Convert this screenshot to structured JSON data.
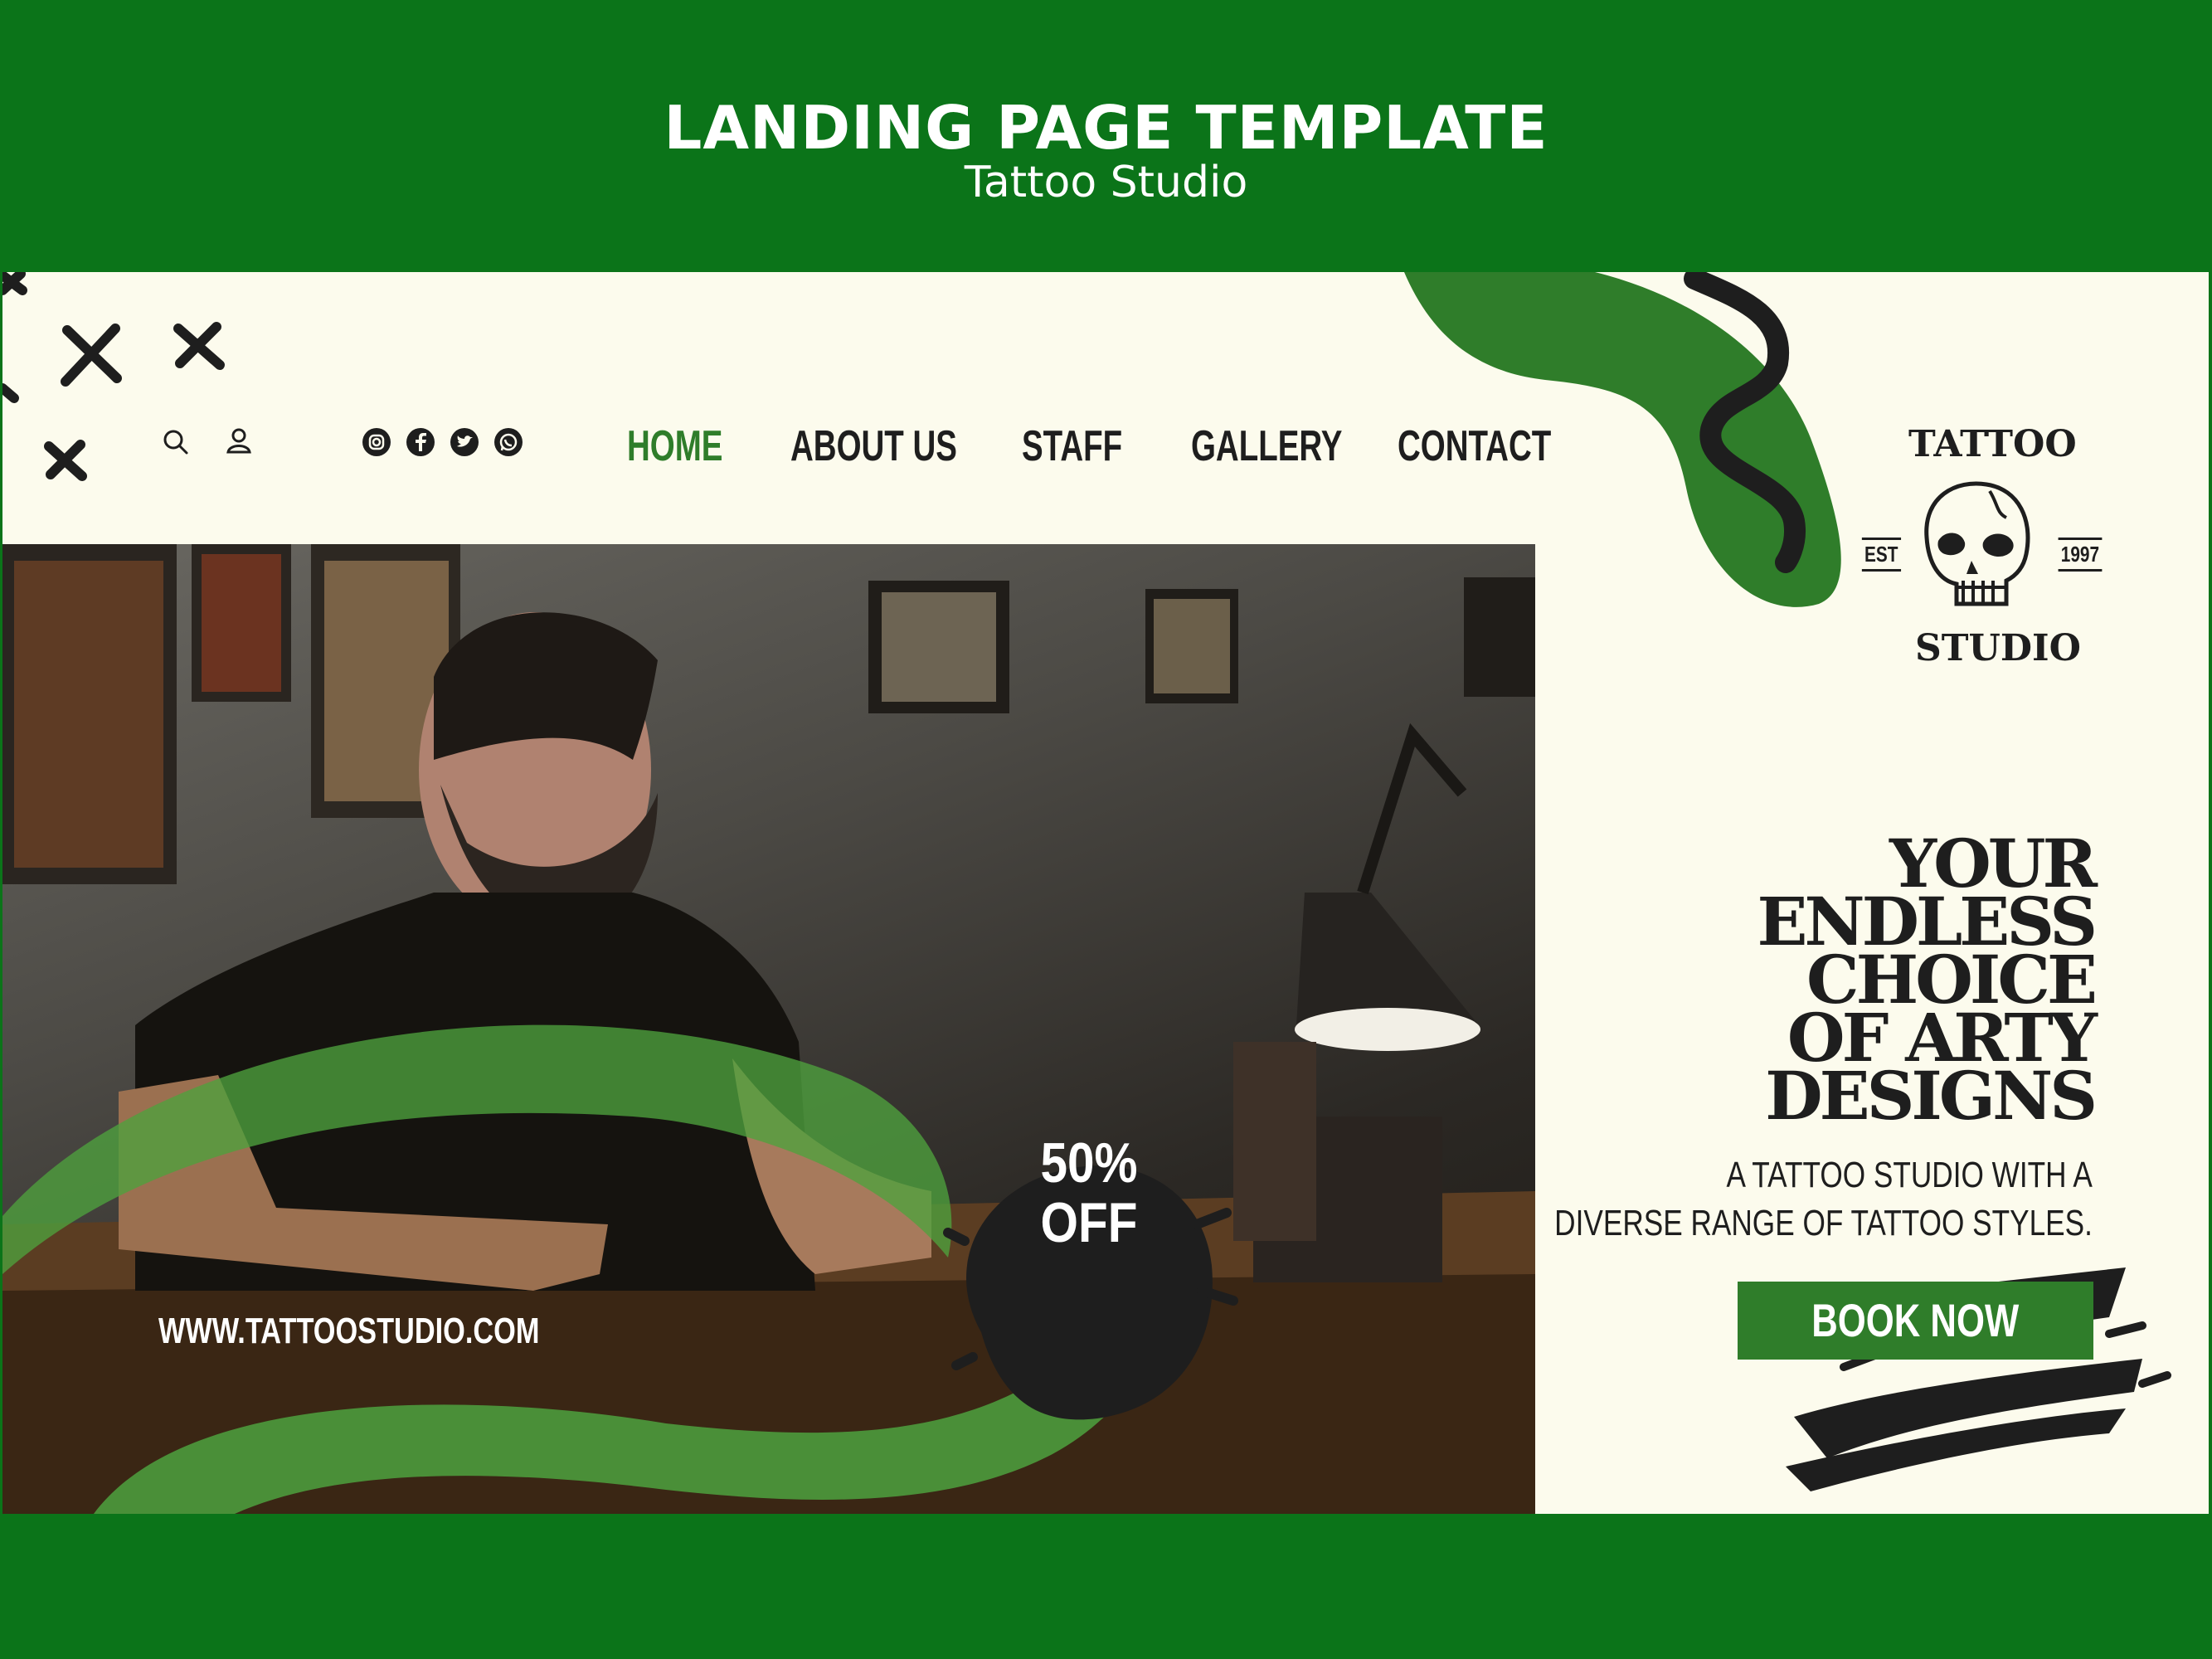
{
  "banner": {
    "title": "LANDING PAGE TEMPLATE",
    "subtitle": "Tattoo Studio"
  },
  "colors": {
    "outer_green": "#0b7419",
    "accent_green": "#2f7d2a",
    "cream": "#fcfbed",
    "ink": "#1e1e1e"
  },
  "header_icons": [
    "search-icon",
    "user-icon"
  ],
  "social_icons": [
    "instagram-icon",
    "facebook-icon",
    "twitter-icon",
    "whatsapp-icon"
  ],
  "nav": {
    "items": [
      {
        "label": "HOME",
        "active": true
      },
      {
        "label": "ABOUT US",
        "active": false
      },
      {
        "label": "STAFF",
        "active": false
      },
      {
        "label": "GALLERY",
        "active": false
      },
      {
        "label": "CONTACT",
        "active": false
      }
    ]
  },
  "logo": {
    "top_text": "TATTOO",
    "bottom_text": "STUDIO",
    "est": "EST",
    "year": "1997",
    "icon": "skull-icon"
  },
  "hero": {
    "website": "WWW.TATTOOSTUDIO.COM",
    "promo": {
      "line1": "50%",
      "line2": "OFF"
    }
  },
  "headline": {
    "lines": [
      "YOUR",
      "ENDLESS",
      "CHOICE",
      "OF ARTY",
      "DESIGNS"
    ]
  },
  "tagline": {
    "lines": [
      "A TATTOO STUDIO WITH A",
      "DIVERSE RANGE OF TATTOO STYLES."
    ]
  },
  "cta": {
    "label": "BOOK NOW"
  }
}
